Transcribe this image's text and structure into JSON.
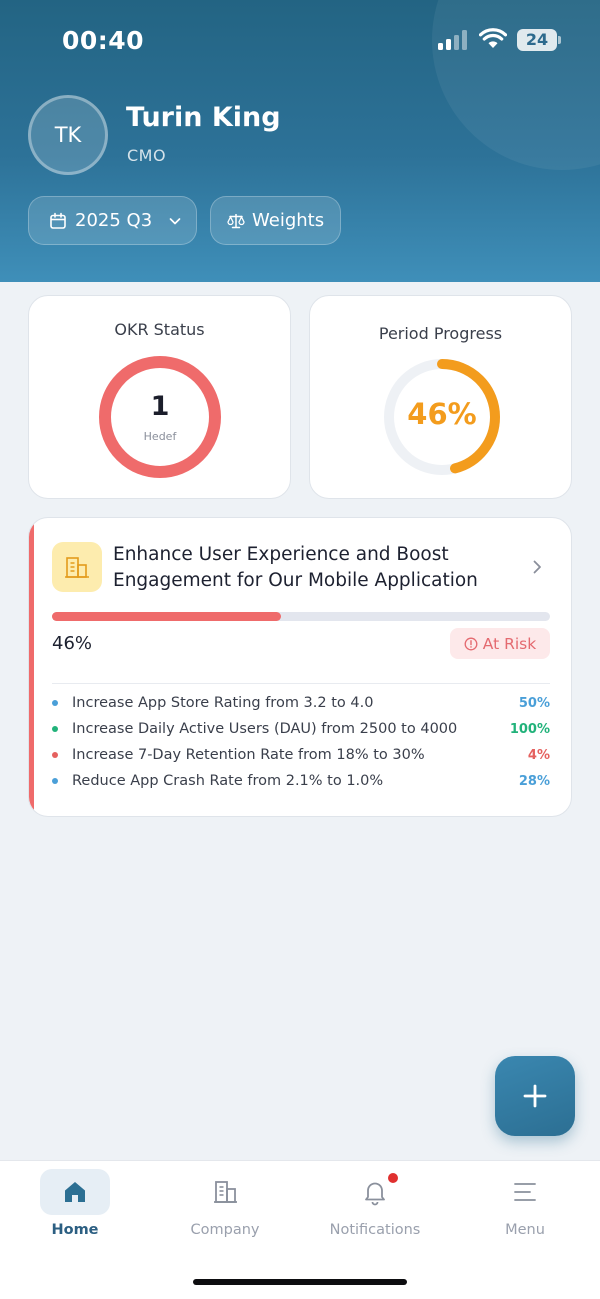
{
  "status_bar": {
    "time": "00:40",
    "battery": "24"
  },
  "profile": {
    "initials": "TK",
    "name": "Turin King",
    "role": "CMO"
  },
  "filters": {
    "period": "2025 Q3",
    "weights": "Weights"
  },
  "okr_status": {
    "title": "OKR Status",
    "count": "1",
    "count_label": "Hedef",
    "ring_color": "#ef6b6b"
  },
  "period_progress": {
    "title": "Period Progress",
    "percent_label": "46%",
    "value": 0.46,
    "color": "#f39c1d"
  },
  "objective": {
    "title_line1": "Enhance User Experience and Boost",
    "title_line2": "Engagement for Our Mobile Application",
    "progress_label": "46%",
    "progress_value": 0.46,
    "status": "At Risk",
    "status_color": "#e46a70",
    "icon": "building-icon",
    "key_results": [
      {
        "text": "Increase App Store Rating from 3.2 to 4.0",
        "percent": "50%",
        "color": "#4a9fd8"
      },
      {
        "text": "Increase Daily Active Users (DAU) from 2500 to 4000",
        "percent": "100%",
        "color": "#21b27a"
      },
      {
        "text": "Increase 7-Day Retention Rate from 18% to 30%",
        "percent": "4%",
        "color": "#e5615f"
      },
      {
        "text": "Reduce App Crash Rate from 2.1% to 1.0%",
        "percent": "28%",
        "color": "#4a9fd8"
      }
    ]
  },
  "fab": {
    "icon": "plus-icon"
  },
  "nav": {
    "home": "Home",
    "company": "Company",
    "notifications": "Notifications",
    "menu": "Menu"
  },
  "colors": {
    "header": "#2d7298",
    "accent": "#2c5f82",
    "risk": "#ef6b6b",
    "progress": "#f39c1d"
  }
}
